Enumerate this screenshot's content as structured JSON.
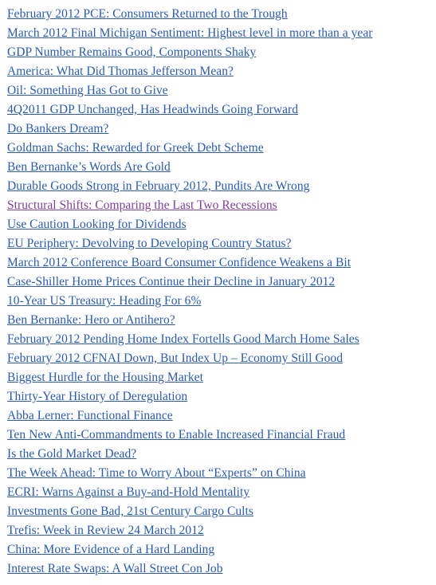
{
  "page": {
    "background_color": "#ffffff",
    "link_color": "#2a5caa",
    "visited_link_color": "#7e3f98"
  },
  "list": {
    "name": "recent-posts-list",
    "items": [
      {
        "label": "February 2012 PCE: Consumers Returned to the Trough",
        "state": "unvisited"
      },
      {
        "label": "March 2012 Final Michigan Sentiment: Highest level in more than a year",
        "state": "unvisited"
      },
      {
        "label": "GDP Number Remains Good, Components Shaky",
        "state": "unvisited"
      },
      {
        "label": "America: What Did Thomas Jefferson Mean?",
        "state": "unvisited"
      },
      {
        "label": "Oil: Something Has Got to Give",
        "state": "unvisited"
      },
      {
        "label": "4Q2011 GDP Unchanged, Has Headwinds Going Forward",
        "state": "unvisited"
      },
      {
        "label": "Do Bankers Dream?",
        "state": "unvisited"
      },
      {
        "label": "Goldman Sachs: Rewarded for Greek Debt Scheme",
        "state": "unvisited"
      },
      {
        "label": "Ben Bernanke’s Words Are Gold",
        "state": "unvisited"
      },
      {
        "label": "Durable Goods Strong in February 2012, Pundits Are Wrong",
        "state": "unvisited"
      },
      {
        "label": "Structural Shifts: Comparing the Last Two Recessions",
        "state": "visited"
      },
      {
        "label": "Use Caution Looking for Dividends",
        "state": "unvisited"
      },
      {
        "label": "EU Periphery: Devolving to Developing Country Status?",
        "state": "unvisited"
      },
      {
        "label": "March 2012 Conference Board Consumer Confidence Weakens a Bit",
        "state": "unvisited"
      },
      {
        "label": "Case-Shiller Home Prices Continue their Decline in January 2012",
        "state": "unvisited"
      },
      {
        "label": "10-Year US Treasury: Heading For 6%",
        "state": "unvisited"
      },
      {
        "label": "Ben Bernanke: Hero or Antihero?",
        "state": "unvisited"
      },
      {
        "label": "February 2012 Pending Home Index Fortells Good March Home Sales",
        "state": "unvisited"
      },
      {
        "label": "February 2012 CFNAI Down, But Index Up – Economy Still Good",
        "state": "unvisited"
      },
      {
        "label": "Biggest Hurdle for the Housing Market",
        "state": "unvisited"
      },
      {
        "label": "Thirty-Year History of Deregulation",
        "state": "unvisited"
      },
      {
        "label": "Abba Lerner: Functional Finance",
        "state": "unvisited"
      },
      {
        "label": "Ten New Anti-Commandments to Enable Increased Financial Fraud",
        "state": "unvisited"
      },
      {
        "label": "Is the Gold Market Dead?",
        "state": "unvisited"
      },
      {
        "label": "The Week Ahead: Time to Worry About “Experts” on China",
        "state": "unvisited"
      },
      {
        "label": "ECRI: Warns Against a Buy-and-Hold Mentality",
        "state": "unvisited"
      },
      {
        "label": "Investments Gone Bad, 21st Century Cargo Cults",
        "state": "unvisited"
      },
      {
        "label": "Trefis: Week in Review 24 March 2012",
        "state": "unvisited"
      },
      {
        "label": "China: More Evidence of a Hard Landing",
        "state": "unvisited"
      },
      {
        "label": "Interest Rate Swaps: A Wall Street Con Job",
        "state": "unvisited"
      }
    ]
  }
}
